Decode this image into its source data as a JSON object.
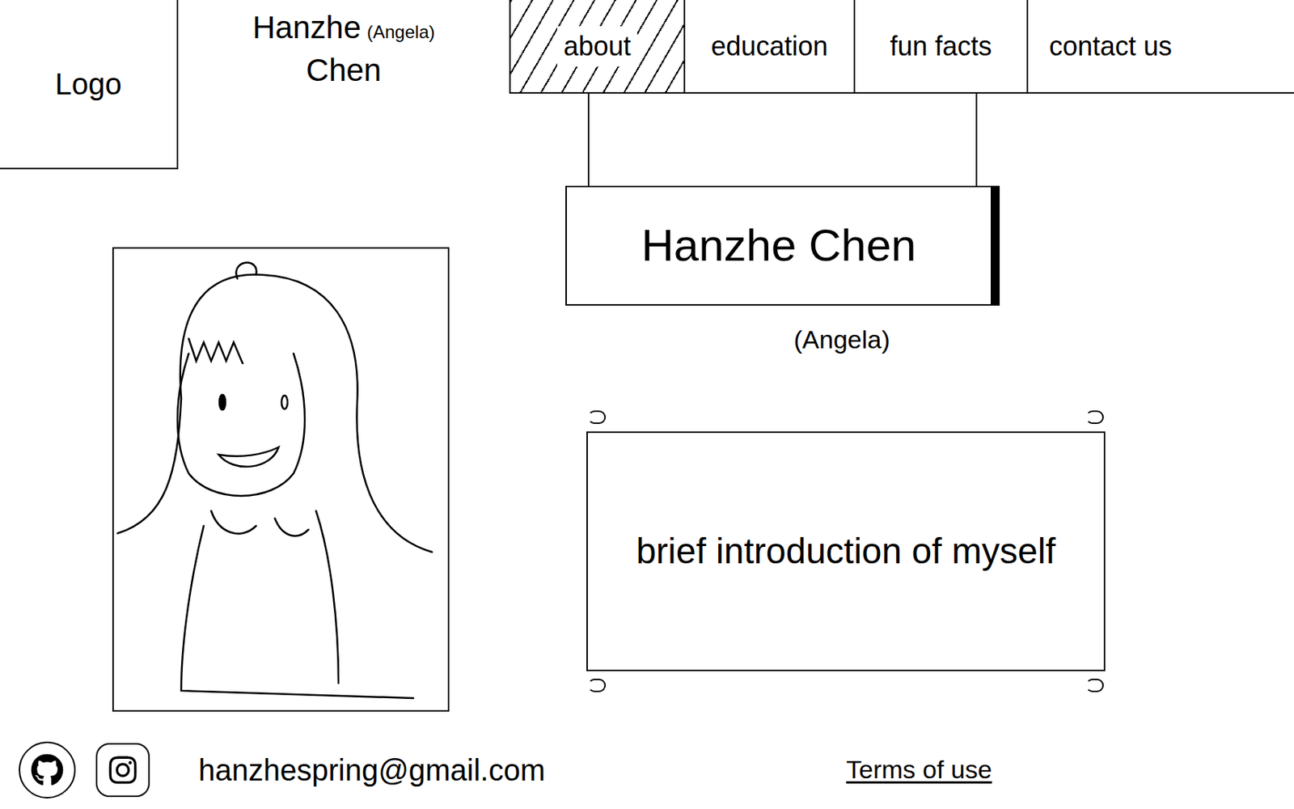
{
  "logo": {
    "label": "Logo"
  },
  "brand": {
    "first": "Hanzhe",
    "nickname": "(Angela)",
    "last": "Chen"
  },
  "nav": [
    {
      "label": "about",
      "selected": true
    },
    {
      "label": "education",
      "selected": false
    },
    {
      "label": "fun facts",
      "selected": false
    },
    {
      "label": "contact us",
      "selected": false
    }
  ],
  "sign": {
    "name": "Hanzhe Chen",
    "nickname": "(Angela)"
  },
  "intro": {
    "text": "brief introduction of myself"
  },
  "footer": {
    "email": "hanzhespring@gmail.com",
    "terms": "Terms of use"
  }
}
